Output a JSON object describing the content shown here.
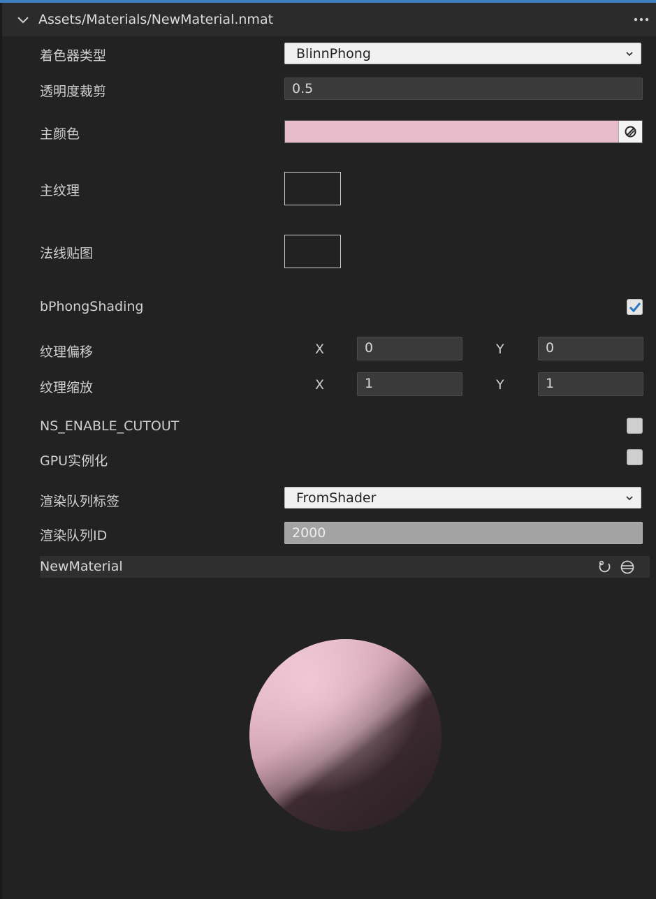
{
  "header": {
    "title": "Assets/Materials/NewMaterial.nmat",
    "collapse_icon": "chevron-down-icon",
    "more_icon": "more-horizontal-icon"
  },
  "properties": {
    "shader_type": {
      "label": "着色器类型",
      "value": "BlinnPhong"
    },
    "alpha_cutoff": {
      "label": "透明度裁剪",
      "value": "0.5"
    },
    "main_color": {
      "label": "主颜色",
      "color": "#e9bccc",
      "picker_icon": "color-picker-icon"
    },
    "main_texture": {
      "label": "主纹理"
    },
    "normal_map": {
      "label": "法线贴图"
    },
    "phong_shading": {
      "label": "bPhongShading",
      "checked": true
    },
    "texture_offset": {
      "label": "纹理偏移",
      "x_label": "X",
      "x_value": "0",
      "y_label": "Y",
      "y_value": "0"
    },
    "texture_scale": {
      "label": "纹理缩放",
      "x_label": "X",
      "x_value": "1",
      "y_label": "Y",
      "y_value": "1"
    },
    "enable_cutout": {
      "label": "NS_ENABLE_CUTOUT",
      "checked": false
    },
    "gpu_instancing": {
      "label": "GPU实例化",
      "checked": false
    },
    "render_queue_tag": {
      "label": "渲染队列标签",
      "value": "FromShader"
    },
    "render_queue_id": {
      "label": "渲染队列ID",
      "value": "2000"
    }
  },
  "preview": {
    "title": "NewMaterial",
    "rotate_icon": "rotate-preview-icon",
    "mesh_icon": "sphere-mesh-icon",
    "sphere_color": "#e9bccc"
  },
  "colors": {
    "background": "#222222",
    "accent": "#3c7fc0",
    "checkbox_tick": "#2b78c2"
  }
}
